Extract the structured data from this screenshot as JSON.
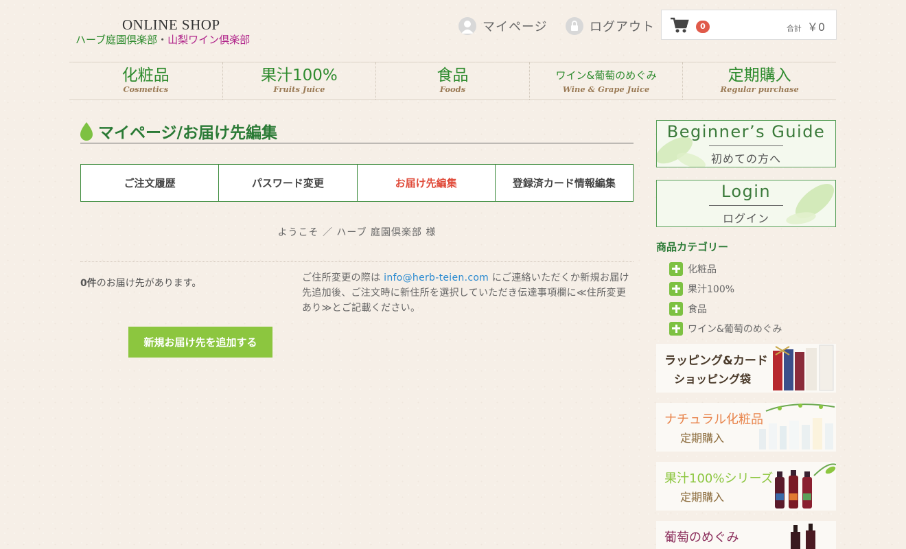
{
  "logo": {
    "top": "ONLINE SHOP",
    "brand_a": "ハーブ庭園倶楽部",
    "dot": "・",
    "brand_b": "山梨ワイン倶楽部"
  },
  "header": {
    "mypage": "マイページ",
    "logout": "ログアウト",
    "cart_count": "0",
    "total_label": "合計",
    "total_value": "￥0"
  },
  "nav": [
    {
      "jp": "化粧品",
      "en": "Cosmetics"
    },
    {
      "jp": "果汁100%",
      "en": "Fruits Juice"
    },
    {
      "jp": "食品",
      "en": "Foods"
    },
    {
      "jp": "ワイン&葡萄のめぐみ",
      "en": "Wine & Grape Juice"
    },
    {
      "jp": "定期購入",
      "en": "Regular purchase"
    }
  ],
  "page": {
    "title": "マイページ/お届け先編集",
    "tabs": [
      "ご注文履歴",
      "パスワード変更",
      "お届け先編集",
      "登録済カード情報編集"
    ],
    "welcome": "ようこそ ／ ハーブ 庭園倶楽部 様",
    "count_num": "0件",
    "count_text": "のお届け先があります。",
    "notice_a": "ご住所変更の際は ",
    "notice_mail": "info@herb-teien.com",
    "notice_b": " にご連絡いただくか新規お届け先追加後、ご注文時に新住所を選択していただき伝達事項欄に≪住所変更あり≫とご記載ください。",
    "add_button": "新規お届け先を追加する"
  },
  "sidebar": {
    "guide_en": "Beginner’s Guide",
    "guide_jp": "初めての方へ",
    "login_en": "Login",
    "login_jp": "ログイン",
    "category_heading": "商品カテゴリー",
    "categories": [
      "化粧品",
      "果汁100%",
      "食品",
      "ワイン&葡萄のめぐみ"
    ],
    "banners": [
      {
        "title": "ラッピング&カード",
        "sub": "ショッピング袋"
      },
      {
        "title": "ナチュラル化粧品",
        "sub": "定期購入"
      },
      {
        "title": "果汁100%シリーズ",
        "sub": "定期購入"
      },
      {
        "title": "葡萄のめぐみ",
        "sub": ""
      }
    ]
  },
  "colors": {
    "brand_green": "#2e8b2e",
    "accent_red": "#e04b3a",
    "button_green": "#8cc63f"
  }
}
